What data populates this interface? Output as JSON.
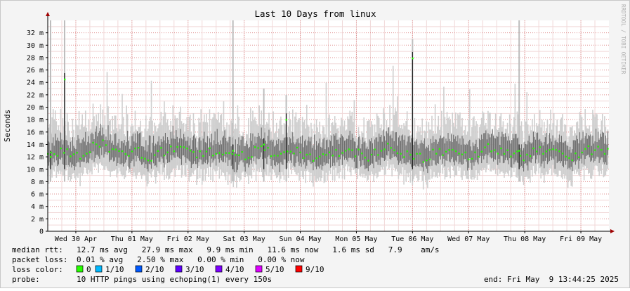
{
  "chart_data": {
    "type": "line",
    "title": "Last 10 Days from linux",
    "ylabel": "Seconds",
    "watermark": "RRDTOOL / TOBI OETIKER",
    "ylim": [
      0,
      34
    ],
    "y_unit": "m",
    "y_ticks": [
      0,
      2,
      4,
      6,
      8,
      10,
      12,
      14,
      16,
      18,
      20,
      22,
      24,
      26,
      28,
      30,
      32
    ],
    "y_tick_labels": [
      "0",
      "2 m",
      "4 m",
      "6 m",
      "8 m",
      "10 m",
      "12 m",
      "14 m",
      "16 m",
      "18 m",
      "20 m",
      "22 m",
      "24 m",
      "26 m",
      "28 m",
      "30 m",
      "32 m"
    ],
    "x_days": [
      {
        "label": "Wed 30 Apr",
        "day": 0.5
      },
      {
        "label": "Thu 01 May",
        "day": 1.5
      },
      {
        "label": "Fri 02 May",
        "day": 2.5
      },
      {
        "label": "Sat 03 May",
        "day": 3.5
      },
      {
        "label": "Sun 04 May",
        "day": 4.5
      },
      {
        "label": "Mon 05 May",
        "day": 5.5
      },
      {
        "label": "Tue 06 May",
        "day": 6.5
      },
      {
        "label": "Wed 07 May",
        "day": 7.5
      },
      {
        "label": "Thu 08 May",
        "day": 8.5
      },
      {
        "label": "Fri 09 May",
        "day": 9.5
      }
    ],
    "median_ms": [
      12.5,
      13.0,
      12.0,
      13.5,
      14.0,
      12.5,
      13.0,
      12.0,
      12.8,
      13.6,
      12.2,
      12.8,
      13.2,
      11.8,
      12.6,
      13.4,
      12.0,
      13.0,
      12.4,
      11.6,
      12.8,
      13.2,
      12.0,
      12.6,
      13.8,
      12.2,
      11.8,
      12.6,
      13.0,
      12.2,
      12.8,
      13.6,
      12.4,
      12.0,
      13.0,
      12.6,
      11.8,
      12.8,
      13.2,
      12.6
    ],
    "spikes": [
      {
        "day": 0.3,
        "max_ms": 34,
        "median_ms": 24.5
      },
      {
        "day": 0.05,
        "max_ms": 34,
        "median_ms": 12.0
      },
      {
        "day": 3.3,
        "max_ms": 34,
        "median_ms": 13.0
      },
      {
        "day": 4.25,
        "max_ms": 22,
        "median_ms": 18.0
      },
      {
        "day": 6.5,
        "max_ms": 31,
        "median_ms": 27.9
      },
      {
        "day": 8.4,
        "max_ms": 34,
        "median_ms": 13.0
      },
      {
        "day": 3.85,
        "max_ms": 23,
        "median_ms": 14.0
      }
    ],
    "stats": {
      "median_rtt": {
        "label": "median rtt:",
        "text": "12.7 ms avg   27.9 ms max   9.9 ms min   11.6 ms now   1.6 ms sd   7.9    am/s"
      },
      "packet_loss": {
        "label": "packet loss:",
        "text": "0.01 % avg   2.50 % max   0.00 % min   0.00 % now"
      },
      "loss_color": {
        "label": "loss color:",
        "items": [
          {
            "label": "0",
            "color": "#26ff00"
          },
          {
            "label": "1/10",
            "color": "#00b8ff"
          },
          {
            "label": "2/10",
            "color": "#0059ff"
          },
          {
            "label": "3/10",
            "color": "#5e00ff"
          },
          {
            "label": "4/10",
            "color": "#7e00ff"
          },
          {
            "label": "5/10",
            "color": "#dd00ff"
          },
          {
            "label": "9/10",
            "color": "#ff0000"
          }
        ]
      },
      "probe": {
        "label": "probe:",
        "text": "10 HTTP pings using echoping(1) every 150s"
      },
      "end": "end: Fri May  9 13:44:25 2025"
    }
  }
}
